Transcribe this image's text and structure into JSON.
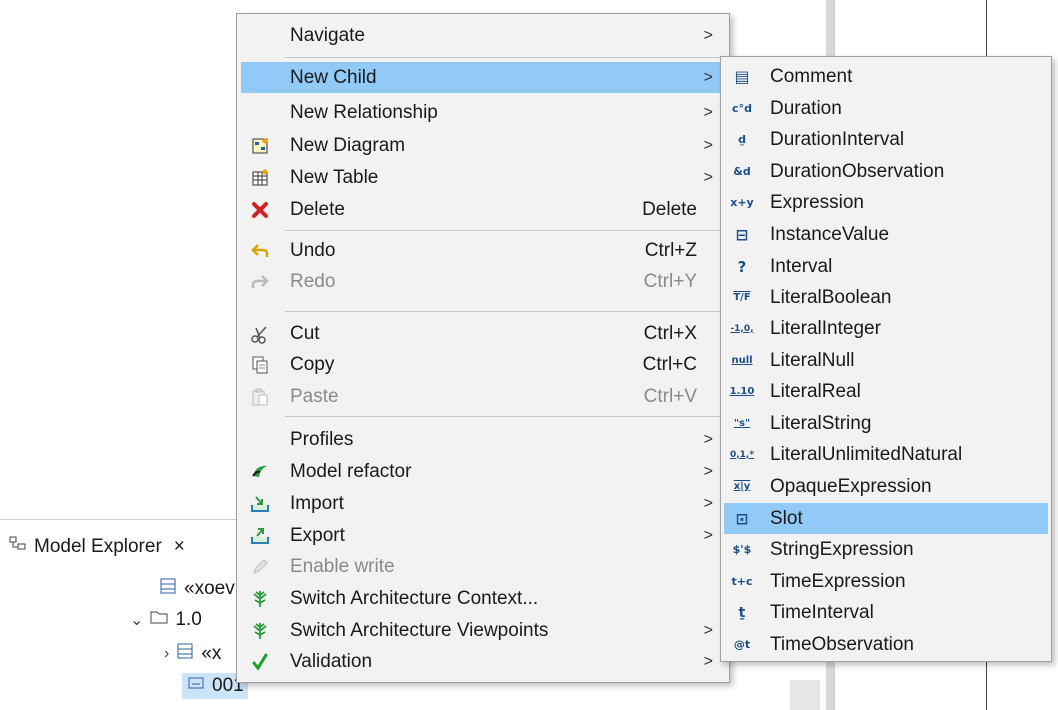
{
  "explorer": {
    "title": "Model Explorer",
    "close_glyph": "×",
    "tree": [
      {
        "label": "«xoev",
        "icon": "model-icon",
        "expander": ""
      },
      {
        "label": "1.0",
        "icon": "folder-icon",
        "expander": "⌄"
      },
      {
        "label": "«x",
        "icon": "model-icon",
        "expander": "›"
      },
      {
        "label": "001",
        "icon": "instance-icon",
        "expander": "",
        "selected": true
      }
    ]
  },
  "context_menu": {
    "items": [
      {
        "label": "Navigate",
        "shortcut": "",
        "submenu": true,
        "icon": ""
      },
      {
        "label": "New Child",
        "shortcut": "",
        "submenu": true,
        "icon": "",
        "highlighted": true
      },
      {
        "label": "New Relationship",
        "shortcut": "",
        "submenu": true,
        "icon": ""
      },
      {
        "label": "New Diagram",
        "shortcut": "",
        "submenu": true,
        "icon": "new-diagram-icon"
      },
      {
        "label": "New Table",
        "shortcut": "",
        "submenu": true,
        "icon": "new-table-icon"
      },
      {
        "label": "Delete",
        "shortcut": "Delete",
        "submenu": false,
        "icon": "delete-icon"
      },
      {
        "label": "Undo",
        "shortcut": "Ctrl+Z",
        "submenu": false,
        "icon": "undo-icon"
      },
      {
        "label": "Redo",
        "shortcut": "Ctrl+Y",
        "submenu": false,
        "icon": "redo-icon",
        "disabled": true
      },
      {
        "label": "Cut",
        "shortcut": "Ctrl+X",
        "submenu": false,
        "icon": "cut-icon"
      },
      {
        "label": "Copy",
        "shortcut": "Ctrl+C",
        "submenu": false,
        "icon": "copy-icon"
      },
      {
        "label": "Paste",
        "shortcut": "Ctrl+V",
        "submenu": false,
        "icon": "paste-icon",
        "disabled": true
      },
      {
        "label": "Profiles",
        "shortcut": "",
        "submenu": true,
        "icon": ""
      },
      {
        "label": "Model refactor",
        "shortcut": "",
        "submenu": true,
        "icon": "refactor-icon"
      },
      {
        "label": "Import",
        "shortcut": "",
        "submenu": true,
        "icon": "import-icon"
      },
      {
        "label": "Export",
        "shortcut": "",
        "submenu": true,
        "icon": "export-icon"
      },
      {
        "label": "Enable write",
        "shortcut": "",
        "submenu": false,
        "icon": "pencil-icon",
        "disabled": true
      },
      {
        "label": "Switch Architecture Context...",
        "shortcut": "",
        "submenu": false,
        "icon": "architecture-icon"
      },
      {
        "label": "Switch Architecture Viewpoints",
        "shortcut": "",
        "submenu": true,
        "icon": "architecture-icon"
      },
      {
        "label": "Validation",
        "shortcut": "",
        "submenu": true,
        "icon": "check-icon"
      }
    ],
    "submenu_arrow": ">"
  },
  "new_child_submenu": {
    "items": [
      {
        "label": "Comment",
        "glyph": "▤"
      },
      {
        "label": "Duration",
        "glyph": "c°d"
      },
      {
        "label": "DurationInterval",
        "glyph": "d̤"
      },
      {
        "label": "DurationObservation",
        "glyph": "&d"
      },
      {
        "label": "Expression",
        "glyph": "x+y"
      },
      {
        "label": "InstanceValue",
        "glyph": "⊟"
      },
      {
        "label": "Interval",
        "glyph": "?"
      },
      {
        "label": "LiteralBoolean",
        "glyph": "T/F"
      },
      {
        "label": "LiteralInteger",
        "glyph": "-1,0,"
      },
      {
        "label": "LiteralNull",
        "glyph": "null"
      },
      {
        "label": "LiteralReal",
        "glyph": "1.10"
      },
      {
        "label": "LiteralString",
        "glyph": "\"s\""
      },
      {
        "label": "LiteralUnlimitedNatural",
        "glyph": "0,1,*"
      },
      {
        "label": "OpaqueExpression",
        "glyph": "x|y"
      },
      {
        "label": "Slot",
        "glyph": "⊡",
        "highlighted": true
      },
      {
        "label": "StringExpression",
        "glyph": "$'$"
      },
      {
        "label": "TimeExpression",
        "glyph": "t+c"
      },
      {
        "label": "TimeInterval",
        "glyph": "ṯ"
      },
      {
        "label": "TimeObservation",
        "glyph": "@t"
      }
    ]
  },
  "colors": {
    "highlight": "#91c9f7",
    "menu_bg": "#f2f2f2",
    "disabled_text": "#8a8a8a"
  }
}
